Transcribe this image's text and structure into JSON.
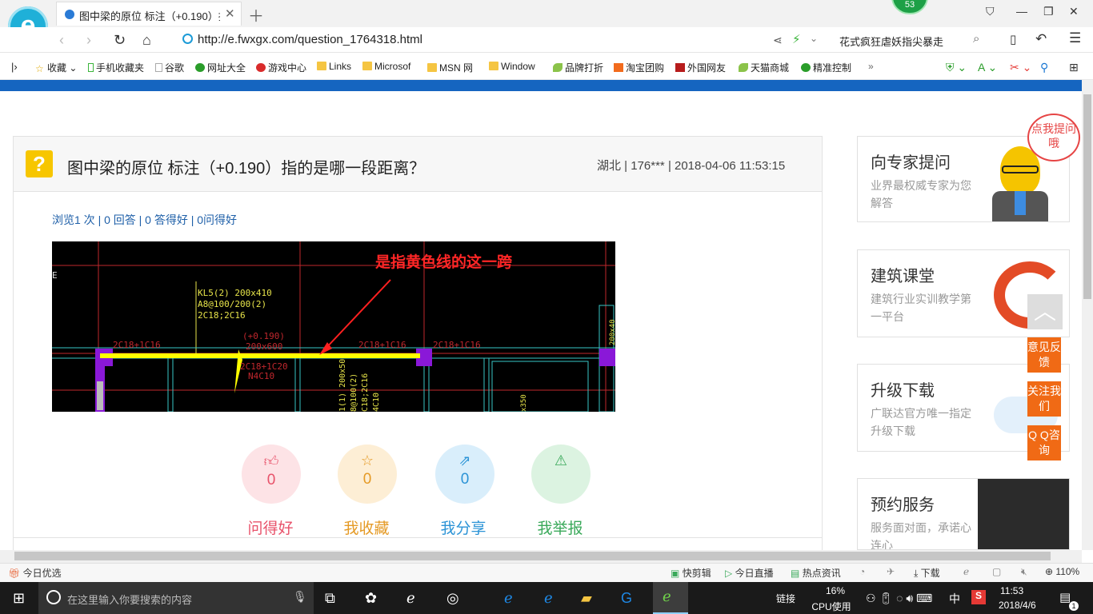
{
  "browser": {
    "tab_title": "图中梁的原位 标注（+0.190）指",
    "url": "http://e.fwxgx.com/question_1764318.html",
    "badge_count": "53",
    "hot_search": "花式疯狂虐妖指尖暴走"
  },
  "bookmarks": [
    {
      "label": "收藏",
      "icon": "star-icon"
    },
    {
      "label": "手机收藏夹",
      "icon": "phone-icon"
    },
    {
      "label": "谷歌",
      "icon": "page-icon"
    },
    {
      "label": "网址大全",
      "icon": "globe-icon"
    },
    {
      "label": "游戏中心",
      "icon": "game-icon"
    },
    {
      "label": "Links",
      "icon": "folder-icon"
    },
    {
      "label": "Microsof",
      "icon": "folder-icon"
    },
    {
      "label": "MSN 网",
      "icon": "folder-icon"
    },
    {
      "label": "Window",
      "icon": "folder-icon"
    },
    {
      "label": "品牌打折",
      "icon": "leaf-icon"
    },
    {
      "label": "淘宝团购",
      "icon": "taobao-icon"
    },
    {
      "label": "外国网友",
      "icon": "flag-icon"
    },
    {
      "label": "天猫商城",
      "icon": "leaf-icon"
    },
    {
      "label": "精准控制",
      "icon": "chat-icon"
    }
  ],
  "question": {
    "title": "图中梁的原位 标注（+0.190）指的是哪一段距离？",
    "meta": "湖北 | 176*** | 2018-04-06 11:53:15",
    "stats": "浏览1 次 | 0 回答 | 0 答得好 | 0问得好"
  },
  "cad": {
    "annotation": "是指黄色线的这一跨",
    "beam_label": [
      "KL5(2) 200x410",
      "A8@100/200(2)",
      "2C18;2C16"
    ],
    "top_rebar": "2C18+1C16",
    "elevation": "(+0.190)",
    "section": "200x600",
    "bottom_rebar": [
      "2C18+1C20",
      "N4C10"
    ],
    "vertical_text": [
      "1(1) 200x50",
      "8@100(2)",
      "C18;2C16",
      "4C10"
    ],
    "side_text": [
      "200x40",
      "x350"
    ]
  },
  "actions": [
    {
      "count": "0",
      "label": "问得好",
      "icon": "thumbs-up-icon",
      "color": "#e8526a",
      "bg": "#fde3e6"
    },
    {
      "count": "0",
      "label": "我收藏",
      "icon": "star-icon",
      "color": "#e59a25",
      "bg": "#fdeed5"
    },
    {
      "count": "0",
      "label": "我分享",
      "icon": "share-icon",
      "color": "#2b93d6",
      "bg": "#d9eefb"
    },
    {
      "count": "0",
      "label": "我举报",
      "icon": "warning-icon",
      "color": "#3aa95a",
      "bg": "#dcf3e1"
    }
  ],
  "sidebar": [
    {
      "title": "向专家提问",
      "desc": "业界最权威专家为您解答"
    },
    {
      "title": "建筑课堂",
      "desc": "建筑行业实训教学第一平台"
    },
    {
      "title": "升级下载",
      "desc": "广联达官方唯一指定升级下载"
    },
    {
      "title": "预约服务",
      "desc": "服务面对面，承诺心连心"
    }
  ],
  "float": {
    "bubble": "点我提问哦",
    "feedback": "意见反馈",
    "follow": "关注我们",
    "qq": "Q Q咨询"
  },
  "statusbar": {
    "left": "今日优选",
    "items": [
      "快剪辑",
      "今日直播",
      "热点资讯",
      "下载"
    ],
    "zoom": "110%"
  },
  "taskbar": {
    "search_placeholder": "在这里输入你要搜索的内容",
    "links": "链接",
    "cpu_pct": "16%",
    "cpu_label": "CPU使用",
    "ime": "中",
    "time": "11:53",
    "date": "2018/4/6",
    "notif_count": "1"
  }
}
